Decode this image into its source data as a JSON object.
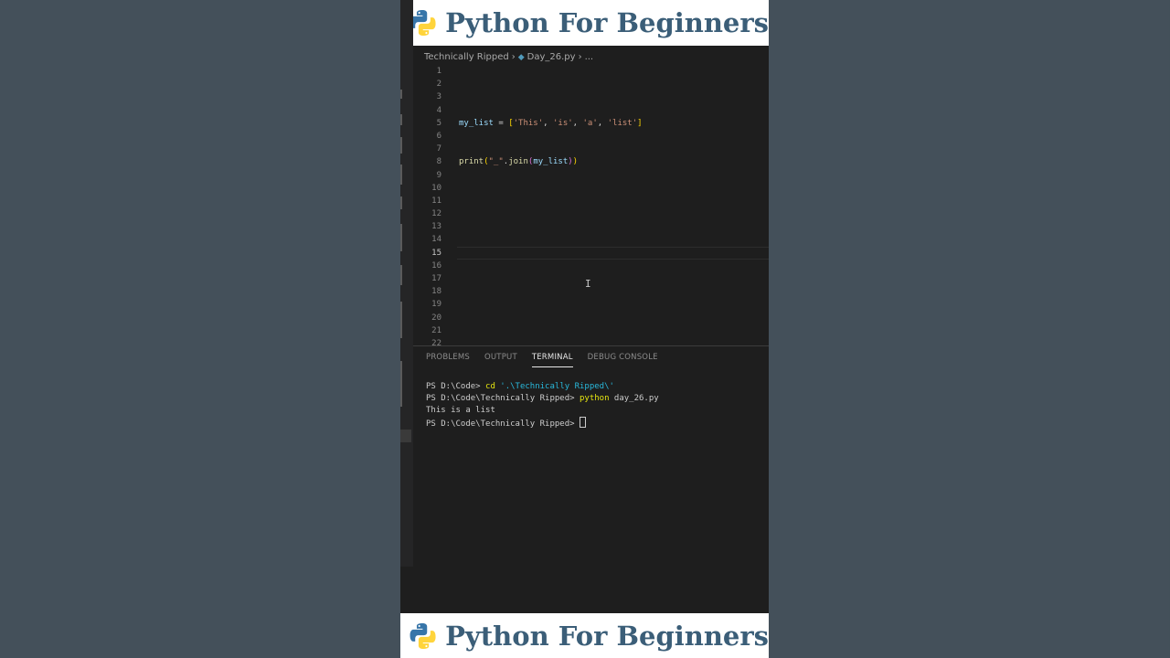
{
  "banner": {
    "title": "Python For Beginners"
  },
  "editor": {
    "breadcrumb": {
      "folder": "Technically Ripped",
      "file": "Day_26.py",
      "more": "..."
    },
    "active_line": 15,
    "line_numbers": [
      "1",
      "2",
      "3",
      "4",
      "5",
      "6",
      "7",
      "8",
      "9",
      "10",
      "11",
      "12",
      "13",
      "14",
      "15",
      "16",
      "17",
      "18",
      "19",
      "20",
      "21",
      "22"
    ],
    "code": {
      "line5": {
        "var": "my_list",
        "op": " = ",
        "open": "[",
        "s1": "'This'",
        "c1": ", ",
        "s2": "'is'",
        "c2": ", ",
        "s3": "'a'",
        "c3": ", ",
        "s4": "'list'",
        "close": "]"
      },
      "line8": {
        "fn": "print",
        "open": "(",
        "str": "\"_\"",
        "dot": ".",
        "method": "join",
        "open2": "(",
        "arg": "my_list",
        "close2": ")",
        "close": ")"
      }
    },
    "cursor_glyph": "I"
  },
  "panel": {
    "tabs": [
      "PROBLEMS",
      "OUTPUT",
      "TERMINAL",
      "DEBUG CONSOLE"
    ],
    "active_tab": "TERMINAL",
    "terminal": {
      "l1_prompt": "PS D:\\Code> ",
      "l1_cmd": "cd",
      "l1_arg": " '.\\Technically Ripped\\'",
      "l2_prompt": "PS D:\\Code\\Technically Ripped> ",
      "l2_cmd": "python",
      "l2_arg": " day_26.py",
      "l3_output": "This is a list",
      "l4_prompt": "PS D:\\Code\\Technically Ripped> "
    }
  },
  "colors": {
    "background": "#435059",
    "banner_text": "#3b5e78",
    "python_blue": "#3775a9",
    "python_yellow": "#ffd43b"
  }
}
